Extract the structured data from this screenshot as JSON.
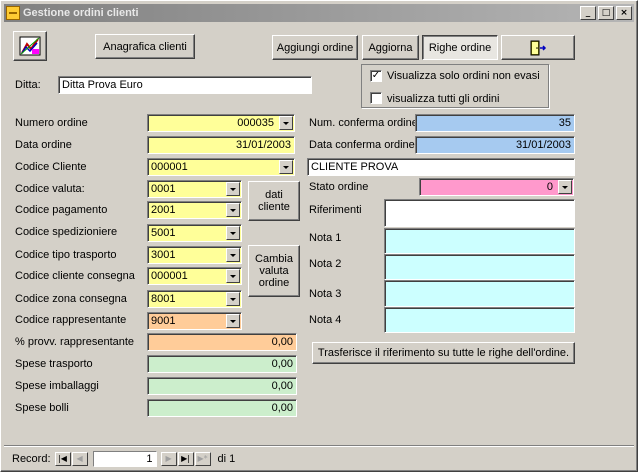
{
  "window": {
    "title": "Gestione ordini clienti",
    "min_glyph": "_",
    "max_glyph": "□",
    "close_glyph": "×"
  },
  "toolbar": {
    "anagrafica": "Anagrafica clienti",
    "aggiungi": "Aggiungi ordine",
    "aggiorna": "Aggiorna",
    "righe": "Righe ordine"
  },
  "ditta": {
    "label": "Ditta:",
    "value": "Ditta Prova Euro"
  },
  "filters": {
    "solo_non_evasi": "Visualizza solo ordini non evasi",
    "solo_non_evasi_checked": true,
    "tutti": "visualizza tutti gli ordini",
    "tutti_checked": false,
    "check_glyph": "✓"
  },
  "left": {
    "numero_ordine": {
      "label": "Numero ordine",
      "value": "000035"
    },
    "data_ordine": {
      "label": "Data ordine",
      "value": "31/01/2003"
    },
    "codice_cliente": {
      "label": "Codice Cliente",
      "value": "000001"
    },
    "codice_valuta": {
      "label": "Codice valuta:",
      "value": "0001"
    },
    "codice_pagamento": {
      "label": "Codice pagamento",
      "value": "2001"
    },
    "codice_spedizioniere": {
      "label": "Codice spedizioniere",
      "value": "5001"
    },
    "codice_tipo_trasporto": {
      "label": "Codice tipo trasporto",
      "value": "3001"
    },
    "codice_cliente_consegna": {
      "label": "Codice cliente consegna",
      "value": "000001"
    },
    "codice_zona_consegna": {
      "label": "Codice zona consegna",
      "value": "8001"
    },
    "codice_rappresentante": {
      "label": "Codice rappresentante",
      "value": "9001"
    },
    "provv_rappresentante": {
      "label": "% provv.  rappresentante",
      "value": "0,00"
    },
    "spese_trasporto": {
      "label": "Spese trasporto",
      "value": "0,00"
    },
    "spese_imballaggi": {
      "label": "Spese imballaggi",
      "value": "0,00"
    },
    "spese_bolli": {
      "label": "Spese bolli",
      "value": "0,00"
    }
  },
  "middle_buttons": {
    "dati_cliente": "dati cliente",
    "cambia_valuta": "Cambia valuta ordine"
  },
  "right": {
    "num_conferma": {
      "label": "Num. conferma ordine",
      "value": "35"
    },
    "data_conferma": {
      "label": "Data conferma ordine",
      "value": "31/01/2003"
    },
    "cliente_nome": "CLIENTE PROVA",
    "stato_ordine": {
      "label": "Stato ordine",
      "value": "0"
    },
    "riferimenti": {
      "label": "Riferimenti",
      "value": ""
    },
    "nota1": {
      "label": "Nota 1",
      "value": ""
    },
    "nota2": {
      "label": "Nota 2",
      "value": ""
    },
    "nota3": {
      "label": "Nota 3",
      "value": ""
    },
    "nota4": {
      "label": "Nota 4",
      "value": ""
    },
    "trasferisce": "Trasferisce il riferimento su tutte le righe dell'ordine."
  },
  "status": {
    "record_label": "Record:",
    "current": "1",
    "total_text": "di 1",
    "first_glyph": "|◀",
    "prev_glyph": "◀",
    "next_glyph": "▶",
    "last_glyph": "▶|",
    "new_glyph": "▶*"
  },
  "colors": {
    "yellow": "#ffff99",
    "cyan": "#ccffff",
    "blue": "#a6caf0",
    "pink": "#ff99cc",
    "orange": "#ffcc99",
    "green": "#cceecc"
  },
  "icons": {
    "report": "report-icon",
    "exit": "exit-door-icon"
  }
}
